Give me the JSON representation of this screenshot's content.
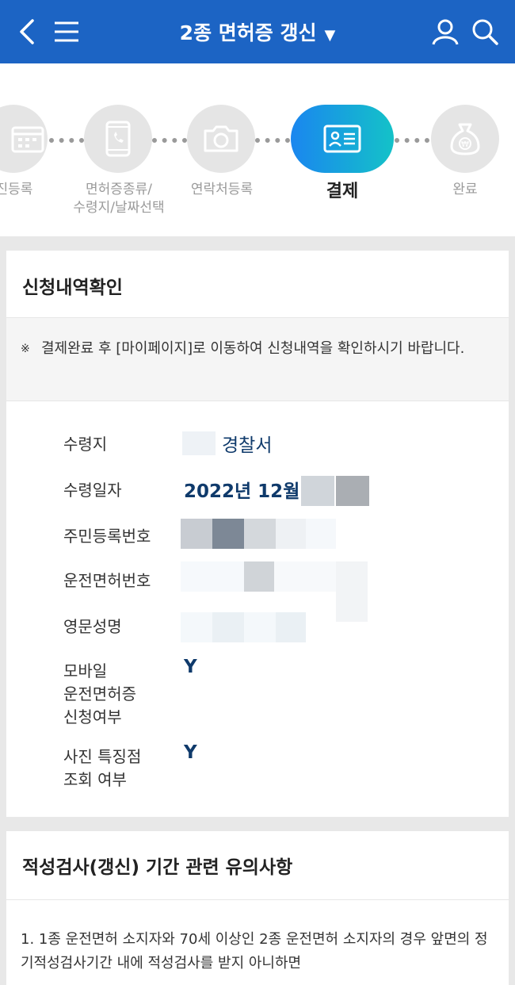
{
  "header": {
    "title": "2종 면허증 갱신",
    "icons": [
      "back-icon",
      "menu-icon",
      "user-icon",
      "search-icon"
    ]
  },
  "steps": [
    {
      "label": "진등록",
      "icon": "calendar-icon"
    },
    {
      "label": "면허증종류/\n수령지/날짜선택",
      "icon": "phone-icon"
    },
    {
      "label": "연락처등록",
      "icon": "camera-icon"
    },
    {
      "label": "결제",
      "icon": "id-card-icon",
      "active": true
    },
    {
      "label": "완료",
      "icon": "coin-bag-icon"
    }
  ],
  "application": {
    "title": "신청내역확인",
    "notice_mark": "※",
    "notice": "결제완료 후 [마이페이지]로 이동하여 신청내역을 확인하시기 바랍니다.",
    "rows": {
      "pickup_place": {
        "label": "수령지",
        "value": "경찰서"
      },
      "pickup_date": {
        "label": "수령일자",
        "value": "2022년 12월"
      },
      "resident_no": {
        "label": "주민등록번호"
      },
      "license_no": {
        "label": "운전면허번호"
      },
      "english_name": {
        "label": "영문성명"
      },
      "mobile_license": {
        "label": "모바일\n운전면허증\n신청여부",
        "value": "Y"
      },
      "photo_lookup": {
        "label": "사진 특징점\n조회 여부",
        "value": "Y"
      }
    }
  },
  "aptitude": {
    "title": "적성검사(갱신) 기간 관련 유의사항",
    "text": "1. 1종 운전면허 소지자와 70세 이상인 2종 운전면허 소지자의 경우 앞면의 정기적성검사기간 내에 적성검사를 받지 아니하면"
  },
  "colors": {
    "header": "#1c64c4",
    "active_step_start": "#1a86ef",
    "active_step_end": "#14c2c8",
    "value_text": "#0f3a6b"
  }
}
